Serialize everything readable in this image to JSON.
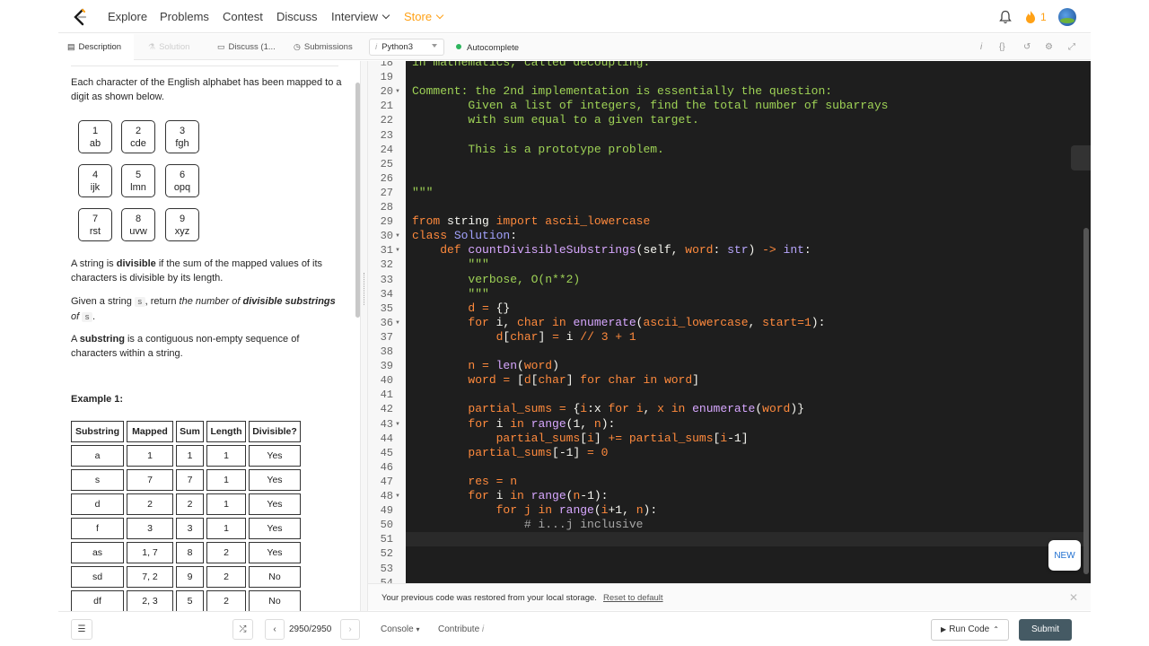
{
  "nav": {
    "items": [
      "Explore",
      "Problems",
      "Contest",
      "Discuss",
      "Interview",
      "Store"
    ],
    "streak": "1"
  },
  "tabs": {
    "description": "Description",
    "solution": "Solution",
    "discuss": "Discuss (1...",
    "submissions": "Submissions",
    "language": "Python3",
    "autocomplete": "Autocomplete"
  },
  "description": {
    "intro": "Each character of the English alphabet has been mapped to a digit as shown below.",
    "keys": [
      {
        "digit": "1",
        "letters": "ab"
      },
      {
        "digit": "2",
        "letters": "cde"
      },
      {
        "digit": "3",
        "letters": "fgh"
      },
      {
        "digit": "4",
        "letters": "ijk"
      },
      {
        "digit": "5",
        "letters": "lmn"
      },
      {
        "digit": "6",
        "letters": "opq"
      },
      {
        "digit": "7",
        "letters": "rst"
      },
      {
        "digit": "8",
        "letters": "uvw"
      },
      {
        "digit": "9",
        "letters": "xyz"
      }
    ],
    "p2_a": "A string is ",
    "p2_b": "divisible",
    "p2_c": " if the sum of the mapped values of its characters is divisible by its length.",
    "p3_a": "Given a string ",
    "p3_code": "s",
    "p3_b": ", return ",
    "p3_c": "the number of ",
    "p3_d": "divisible substrings",
    "p3_e": " of ",
    "p3_code2": "s",
    "p3_f": ".",
    "p4_a": "A ",
    "p4_b": "substring",
    "p4_c": " is a contiguous non-empty sequence of characters within a string.",
    "example_title": "Example 1:",
    "table_headers": [
      "Substring",
      "Mapped",
      "Sum",
      "Length",
      "Divisible?"
    ],
    "table_rows": [
      [
        "a",
        "1",
        "1",
        "1",
        "Yes"
      ],
      [
        "s",
        "7",
        "7",
        "1",
        "Yes"
      ],
      [
        "d",
        "2",
        "2",
        "1",
        "Yes"
      ],
      [
        "f",
        "3",
        "3",
        "1",
        "Yes"
      ],
      [
        "as",
        "1, 7",
        "8",
        "2",
        "Yes"
      ],
      [
        "sd",
        "7, 2",
        "9",
        "2",
        "No"
      ],
      [
        "df",
        "2, 3",
        "5",
        "2",
        "No"
      ]
    ]
  },
  "editor": {
    "line_numbers": [
      "18",
      "19",
      "20",
      "21",
      "22",
      "23",
      "24",
      "25",
      "26",
      "27",
      "28",
      "29",
      "30",
      "31",
      "32",
      "33",
      "34",
      "35",
      "36",
      "37",
      "38",
      "39",
      "40",
      "41",
      "42",
      "43",
      "44",
      "45",
      "46",
      "47",
      "48",
      "49",
      "50",
      "51",
      "52",
      "53",
      "54"
    ],
    "fold_lines": [
      "20",
      "30",
      "31",
      "36",
      "43",
      "48"
    ],
    "code": [
      [
        [
          "in mathematics, called decoupling.",
          "str"
        ]
      ],
      [],
      [
        [
          "Comment: the 2nd implementation is essentially the question:",
          "str"
        ]
      ],
      [
        [
          "        Given a list of integers, find the total number of subarrays",
          "str"
        ]
      ],
      [
        [
          "        with sum equal to a given target.",
          "str"
        ]
      ],
      [],
      [
        [
          "        This is a prototype problem.",
          "str"
        ]
      ],
      [],
      [],
      [
        [
          "\"\"\"",
          "str"
        ]
      ],
      [],
      [
        [
          "from ",
          "kw"
        ],
        [
          "string ",
          "py"
        ],
        [
          "import ",
          "kw"
        ],
        [
          "ascii_lowercase",
          "var"
        ]
      ],
      [
        [
          "class ",
          "kw"
        ],
        [
          "Solution",
          "cls"
        ],
        [
          ":",
          "py"
        ]
      ],
      [
        [
          "    def ",
          "kw"
        ],
        [
          "countDivisibleSubstrings",
          "fn"
        ],
        [
          "(self, ",
          "py"
        ],
        [
          "word",
          "var"
        ],
        [
          ": ",
          "py"
        ],
        [
          "str",
          "bi"
        ],
        [
          ") ",
          "py"
        ],
        [
          "-> ",
          "kw"
        ],
        [
          "int",
          "bi"
        ],
        [
          ":",
          "py"
        ]
      ],
      [
        [
          "        \"\"\"",
          "str"
        ]
      ],
      [
        [
          "        verbose, O(n**2)",
          "str"
        ]
      ],
      [
        [
          "        \"\"\"",
          "str"
        ]
      ],
      [
        [
          "        d ",
          "var"
        ],
        [
          "= ",
          "kw"
        ],
        [
          "{}",
          "py"
        ]
      ],
      [
        [
          "        for ",
          "kw"
        ],
        [
          "i, ",
          "py"
        ],
        [
          "char ",
          "var"
        ],
        [
          "in ",
          "kw"
        ],
        [
          "enumerate",
          "fn"
        ],
        [
          "(",
          "py"
        ],
        [
          "ascii_lowercase",
          "var"
        ],
        [
          ", ",
          "py"
        ],
        [
          "start",
          "var"
        ],
        [
          "=",
          "kw"
        ],
        [
          "1",
          "num"
        ],
        [
          "):",
          "py"
        ]
      ],
      [
        [
          "            d",
          "var"
        ],
        [
          "[",
          "py"
        ],
        [
          "char",
          "var"
        ],
        [
          "] ",
          "py"
        ],
        [
          "= ",
          "kw"
        ],
        [
          "i ",
          "py"
        ],
        [
          "// ",
          "kw"
        ],
        [
          "3 ",
          "num"
        ],
        [
          "+ ",
          "kw"
        ],
        [
          "1",
          "num"
        ]
      ],
      [],
      [
        [
          "        n ",
          "var"
        ],
        [
          "= ",
          "kw"
        ],
        [
          "len",
          "fn"
        ],
        [
          "(",
          "py"
        ],
        [
          "word",
          "var"
        ],
        [
          ")",
          "py"
        ]
      ],
      [
        [
          "        word ",
          "var"
        ],
        [
          "= ",
          "kw"
        ],
        [
          "[",
          "py"
        ],
        [
          "d",
          "var"
        ],
        [
          "[",
          "py"
        ],
        [
          "char",
          "var"
        ],
        [
          "] ",
          "py"
        ],
        [
          "for ",
          "kw"
        ],
        [
          "char ",
          "var"
        ],
        [
          "in ",
          "kw"
        ],
        [
          "word",
          "var"
        ],
        [
          "]",
          "py"
        ]
      ],
      [],
      [
        [
          "        partial_sums ",
          "var"
        ],
        [
          "= ",
          "kw"
        ],
        [
          "{",
          "py"
        ],
        [
          "i",
          "var"
        ],
        [
          ":x ",
          "py"
        ],
        [
          "for ",
          "kw"
        ],
        [
          "i",
          "var"
        ],
        [
          ", ",
          "py"
        ],
        [
          "x ",
          "var"
        ],
        [
          "in ",
          "kw"
        ],
        [
          "enumerate",
          "fn"
        ],
        [
          "(",
          "py"
        ],
        [
          "word",
          "var"
        ],
        [
          ")}",
          "py"
        ]
      ],
      [
        [
          "        for ",
          "kw"
        ],
        [
          "i ",
          "py"
        ],
        [
          "in ",
          "kw"
        ],
        [
          "range",
          "fn"
        ],
        [
          "(1, ",
          "py"
        ],
        [
          "n",
          "var"
        ],
        [
          "):",
          "py"
        ]
      ],
      [
        [
          "            partial_sums",
          "var"
        ],
        [
          "[",
          "py"
        ],
        [
          "i",
          "var"
        ],
        [
          "] ",
          "py"
        ],
        [
          "+= ",
          "kw"
        ],
        [
          "partial_sums",
          "var"
        ],
        [
          "[",
          "py"
        ],
        [
          "i",
          "var"
        ],
        [
          "-1]",
          "py"
        ]
      ],
      [
        [
          "        partial_sums",
          "var"
        ],
        [
          "[-1] ",
          "py"
        ],
        [
          "= ",
          "kw"
        ],
        [
          "0",
          "num"
        ]
      ],
      [],
      [
        [
          "        res ",
          "var"
        ],
        [
          "= ",
          "kw"
        ],
        [
          "n",
          "var"
        ]
      ],
      [
        [
          "        for ",
          "kw"
        ],
        [
          "i ",
          "py"
        ],
        [
          "in ",
          "kw"
        ],
        [
          "range",
          "fn"
        ],
        [
          "(",
          "py"
        ],
        [
          "n",
          "var"
        ],
        [
          "-1):",
          "py"
        ]
      ],
      [
        [
          "            for ",
          "kw"
        ],
        [
          "j ",
          "var"
        ],
        [
          "in ",
          "kw"
        ],
        [
          "range",
          "fn"
        ],
        [
          "(",
          "py"
        ],
        [
          "i",
          "var"
        ],
        [
          "+1, ",
          "py"
        ],
        [
          "n",
          "var"
        ],
        [
          "):",
          "py"
        ]
      ],
      [
        [
          "                # i...j inclusive",
          "cm"
        ]
      ],
      [],
      [],
      [],
      []
    ],
    "new_badge": "NEW"
  },
  "restore": {
    "message": "Your previous code was restored from your local storage.",
    "reset_link": "Reset to default"
  },
  "bottom": {
    "pager": "2950/2950",
    "console": "Console",
    "contribute": "Contribute",
    "run_code": "Run Code",
    "submit": "Submit"
  },
  "colors": {
    "accent": "#ffa116",
    "submit_bg": "#455a64",
    "editor_bg": "#1e1e1e",
    "green_dot": "#2db55d"
  }
}
